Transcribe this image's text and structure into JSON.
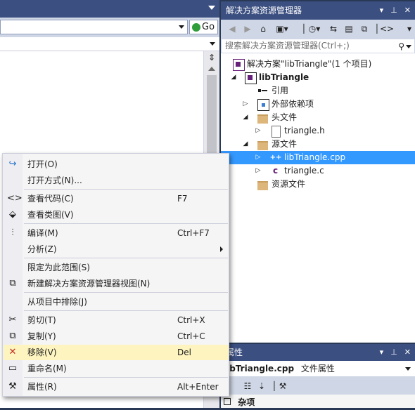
{
  "address": {
    "go_label": "Go"
  },
  "solution_explorer": {
    "title": "解决方案资源管理器",
    "search_placeholder": "搜索解决方案资源管理器(Ctrl+;)",
    "tree": [
      {
        "label": "解决方案\"libTriangle\"(1 个项目)",
        "icon": "solution-icon"
      },
      {
        "label": "libTriangle",
        "icon": "project-icon"
      },
      {
        "label": "引用",
        "icon": "references-icon"
      },
      {
        "label": "外部依赖项",
        "icon": "external-deps-icon"
      },
      {
        "label": "头文件",
        "icon": "folder-icon"
      },
      {
        "label": "triangle.h",
        "icon": "header-file-icon"
      },
      {
        "label": "源文件",
        "icon": "folder-icon"
      },
      {
        "label": "libTriangle.cpp",
        "icon": "cpp-file-icon",
        "selected": true
      },
      {
        "label": "triangle.c",
        "icon": "c-file-icon"
      },
      {
        "label": "资源文件",
        "icon": "folder-icon"
      }
    ]
  },
  "properties": {
    "title": "属性",
    "subject_name": "libTriangle.cpp",
    "subject_type": "文件属性",
    "section": "杂项"
  },
  "context_menu": {
    "items": [
      {
        "label": "打开(O)",
        "shortcut": "",
        "icon": "open-icon"
      },
      {
        "label": "打开方式(N)...",
        "shortcut": "",
        "icon": ""
      },
      {
        "label": "查看代码(C)",
        "shortcut": "F7",
        "icon": "view-code-icon"
      },
      {
        "label": "查看类图(V)",
        "shortcut": "",
        "icon": "class-diagram-icon"
      },
      {
        "label": "编译(M)",
        "shortcut": "Ctrl+F7",
        "icon": "compile-icon"
      },
      {
        "label": "分析(Z)",
        "shortcut": "",
        "icon": ""
      },
      {
        "label": "限定为此范围(S)",
        "shortcut": "",
        "icon": ""
      },
      {
        "label": "新建解决方案资源管理器视图(N)",
        "shortcut": "",
        "icon": "new-view-icon"
      },
      {
        "label": "从项目中排除(J)",
        "shortcut": "",
        "icon": ""
      },
      {
        "label": "剪切(T)",
        "shortcut": "Ctrl+X",
        "icon": "cut-icon"
      },
      {
        "label": "复制(Y)",
        "shortcut": "Ctrl+C",
        "icon": "copy-icon"
      },
      {
        "label": "移除(V)",
        "shortcut": "Del",
        "icon": "remove-icon",
        "highlighted": true
      },
      {
        "label": "重命名(M)",
        "shortcut": "",
        "icon": "rename-icon"
      },
      {
        "label": "属性(R)",
        "shortcut": "Alt+Enter",
        "icon": "properties-icon"
      }
    ]
  },
  "colors": {
    "title_bar": "#3b4f81",
    "selection": "#3399ff",
    "menu_highlight": "#fdf4bf",
    "remove_icon": "#c42b1c"
  }
}
